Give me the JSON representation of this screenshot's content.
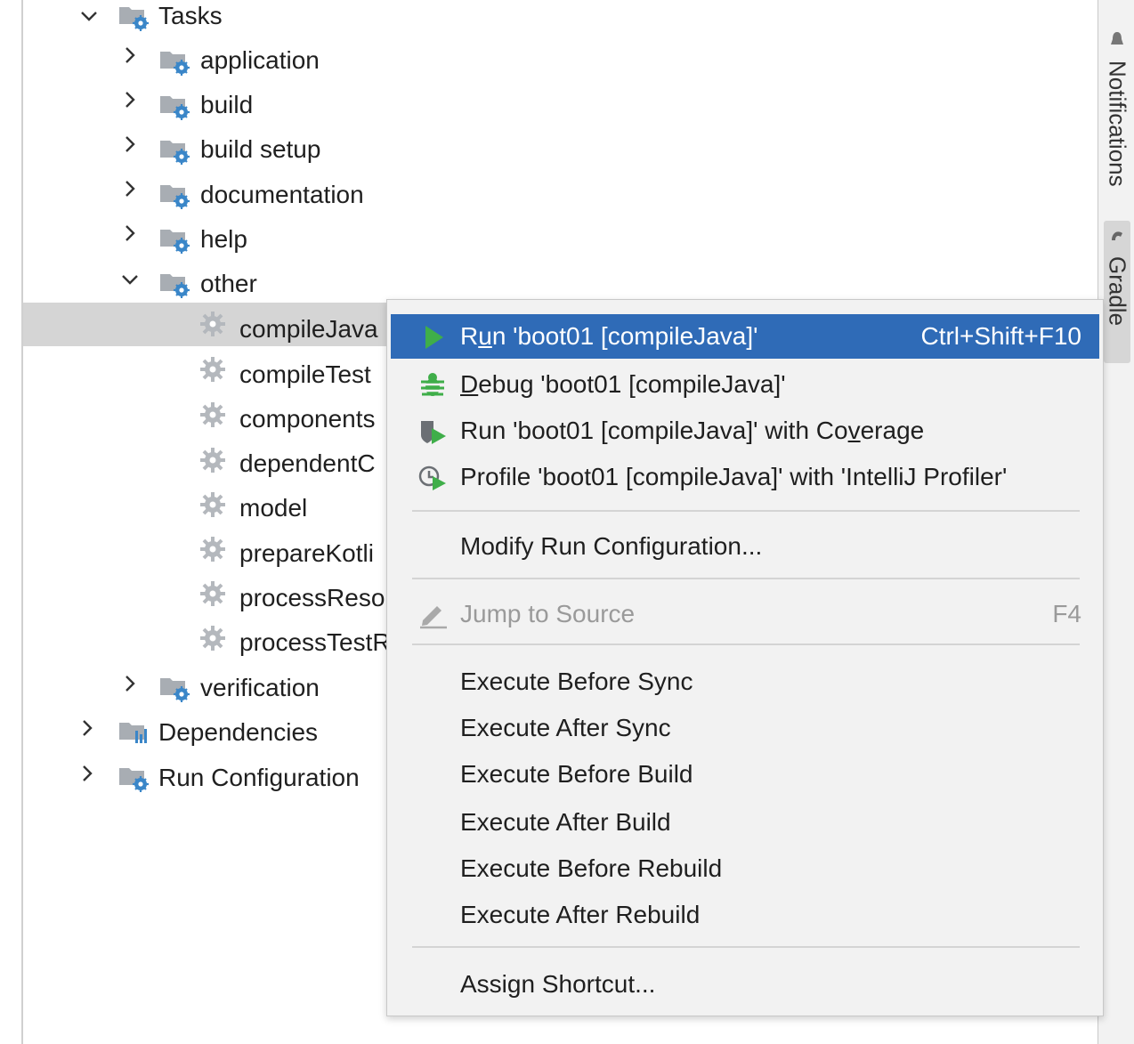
{
  "tree": {
    "tasks_label": "Tasks",
    "groups": [
      {
        "label": "application"
      },
      {
        "label": "build"
      },
      {
        "label": "build setup"
      },
      {
        "label": "documentation"
      },
      {
        "label": "help"
      },
      {
        "label": "other"
      }
    ],
    "other_tasks": [
      {
        "label": "compileJava"
      },
      {
        "label": "compileTest"
      },
      {
        "label": "components"
      },
      {
        "label": "dependentC"
      },
      {
        "label": "model"
      },
      {
        "label": "prepareKotli"
      },
      {
        "label": "processReso"
      },
      {
        "label": "processTestR"
      }
    ],
    "verification_label": "verification",
    "dependencies_label": "Dependencies",
    "run_configurations_label": "Run Configuration"
  },
  "right_stripe": {
    "notifications_label": "Notifications",
    "gradle_label": "Gradle"
  },
  "context_menu": {
    "run": {
      "pre": "R",
      "mn": "u",
      "post": "n 'boot01 [compileJava]'",
      "shortcut": "Ctrl+Shift+F10"
    },
    "debug": {
      "mn": "D",
      "post": "ebug 'boot01 [compileJava]'"
    },
    "coverage": {
      "pre": "Run 'boot01 [compileJava]' with Co",
      "mn": "v",
      "post": "erage"
    },
    "profile": {
      "label": "Profile 'boot01 [compileJava]' with 'IntelliJ Profiler'"
    },
    "modify": {
      "label": "Modify Run Configuration..."
    },
    "jump": {
      "label": "Jump to Source",
      "shortcut": "F4"
    },
    "exec_before_sync": {
      "label": "Execute Before Sync"
    },
    "exec_after_sync": {
      "label": "Execute After Sync"
    },
    "exec_before_build": {
      "label": "Execute Before Build"
    },
    "exec_after_build": {
      "label": "Execute After Build"
    },
    "exec_before_rebuild": {
      "label": "Execute Before Rebuild"
    },
    "exec_after_rebuild": {
      "label": "Execute After Rebuild"
    },
    "assign_shortcut": {
      "label": "Assign Shortcut..."
    }
  },
  "colors": {
    "menu_highlight": "#2f6bb7",
    "run_green": "#3fae49",
    "folder_gray": "#a8adb3",
    "gear_blue": "#3a86c8"
  }
}
